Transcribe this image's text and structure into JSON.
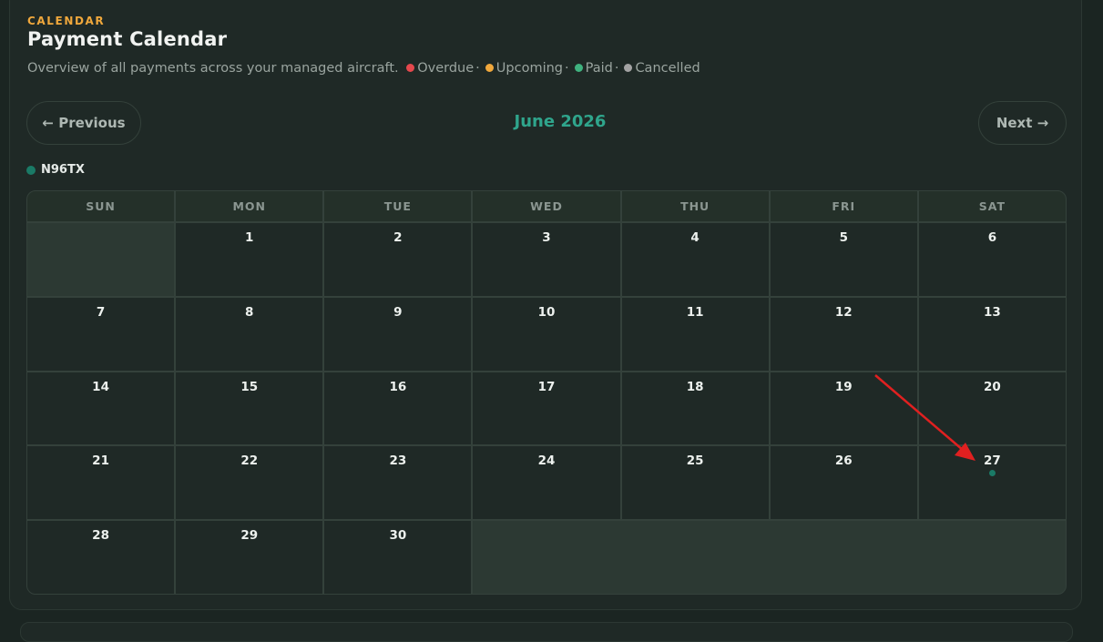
{
  "header": {
    "eyebrow": "CALENDAR",
    "title": "Payment Calendar",
    "subtitle_prefix": "Overview of all payments across your managed aircraft.",
    "statuses": [
      {
        "label": "Overdue",
        "color": "#e5484d"
      },
      {
        "label": "Upcoming",
        "color": "#f0a83c"
      },
      {
        "label": "Paid",
        "color": "#3fb27f"
      },
      {
        "label": "Cancelled",
        "color": "#a3a3a3"
      }
    ],
    "separator": "·"
  },
  "nav": {
    "prev_label": "← Previous",
    "next_label": "Next →",
    "month_label": "June 2026"
  },
  "aircraft_legend": {
    "label": "N96TX",
    "color": "#1a7a66"
  },
  "calendar": {
    "weekdays": [
      "SUN",
      "MON",
      "TUE",
      "WED",
      "THU",
      "FRI",
      "SAT"
    ],
    "leading_empty": 1,
    "days": [
      "1",
      "2",
      "3",
      "4",
      "5",
      "6",
      "7",
      "8",
      "9",
      "10",
      "11",
      "12",
      "13",
      "14",
      "15",
      "16",
      "17",
      "18",
      "19",
      "20",
      "21",
      "22",
      "23",
      "24",
      "25",
      "26",
      "27",
      "28",
      "29",
      "30"
    ],
    "event_days": [
      "27"
    ]
  },
  "annotation": {
    "arrow_color": "#e02020"
  }
}
